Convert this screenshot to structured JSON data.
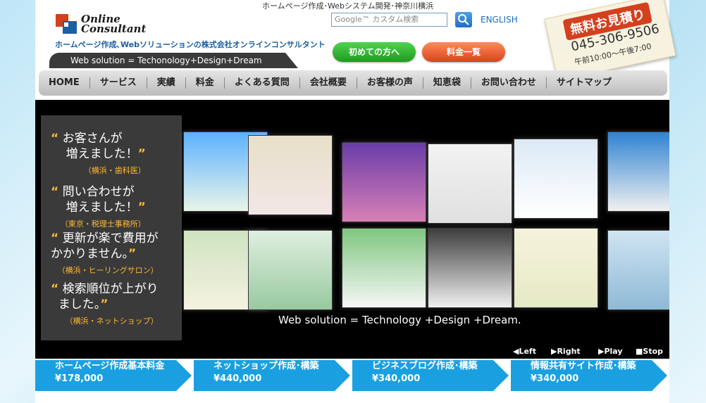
{
  "header": {
    "top_caption": "ホームページ作成･Webシステム開発･神奈川横浜",
    "logo_line1": "Online",
    "logo_line2": "Consultant",
    "tagline": "ホームページ作成､Webソリューションの株式会社オンラインコンサルタント",
    "search_placeholder": "Google™ カスタム検索",
    "english": "ENGLISH",
    "btn_first": "初めての方へ",
    "btn_price": "料金一覧",
    "solution": "Web solution = Techonology+Design+Dream",
    "badge_title": "無料お見積り",
    "badge_phone": "045-306-9506",
    "badge_hours": "午前10:00〜午後7:00"
  },
  "nav": [
    "HOME",
    "サービス",
    "実績",
    "料金",
    "よくある質問",
    "会社概要",
    "お客様の声",
    "知恵袋",
    "お問い合わせ",
    "サイトマップ"
  ],
  "hero": {
    "quotes": [
      {
        "text1": "お客さんが",
        "text2": "増えました！",
        "cite": "（横浜・歯科医）"
      },
      {
        "text1": "問い合わせが",
        "text2": "増えました！",
        "cite": "（東京・税理士事務所）"
      },
      {
        "text1": "更新が楽で費用が",
        "text2": "かかりません。",
        "cite": "（横浜・ヒーリングサロン）"
      },
      {
        "text1": "検索順位が上がり",
        "text2": "ました。",
        "cite": "（横浜・ネットショップ）"
      }
    ],
    "tagline": "Web solution = Technology +Design +Dream."
  },
  "controls": {
    "left": "◀Left",
    "right": "▶Right",
    "play": "▶Play",
    "stop": "■Stop"
  },
  "tiles": [
    {
      "title": "ホームページ作成基本料金",
      "price": "¥178,000"
    },
    {
      "title": "ネットショップ作成･構築",
      "price": "¥440,000"
    },
    {
      "title": "ビジネスブログ作成･構築",
      "price": "¥340,000"
    },
    {
      "title": "情報共有サイト作成･構築",
      "price": "¥340,000"
    }
  ],
  "colors": {
    "accent": "#1aa0e0",
    "green": "#2faa2f",
    "orange": "#e0552a",
    "quote": "#ffb833"
  }
}
